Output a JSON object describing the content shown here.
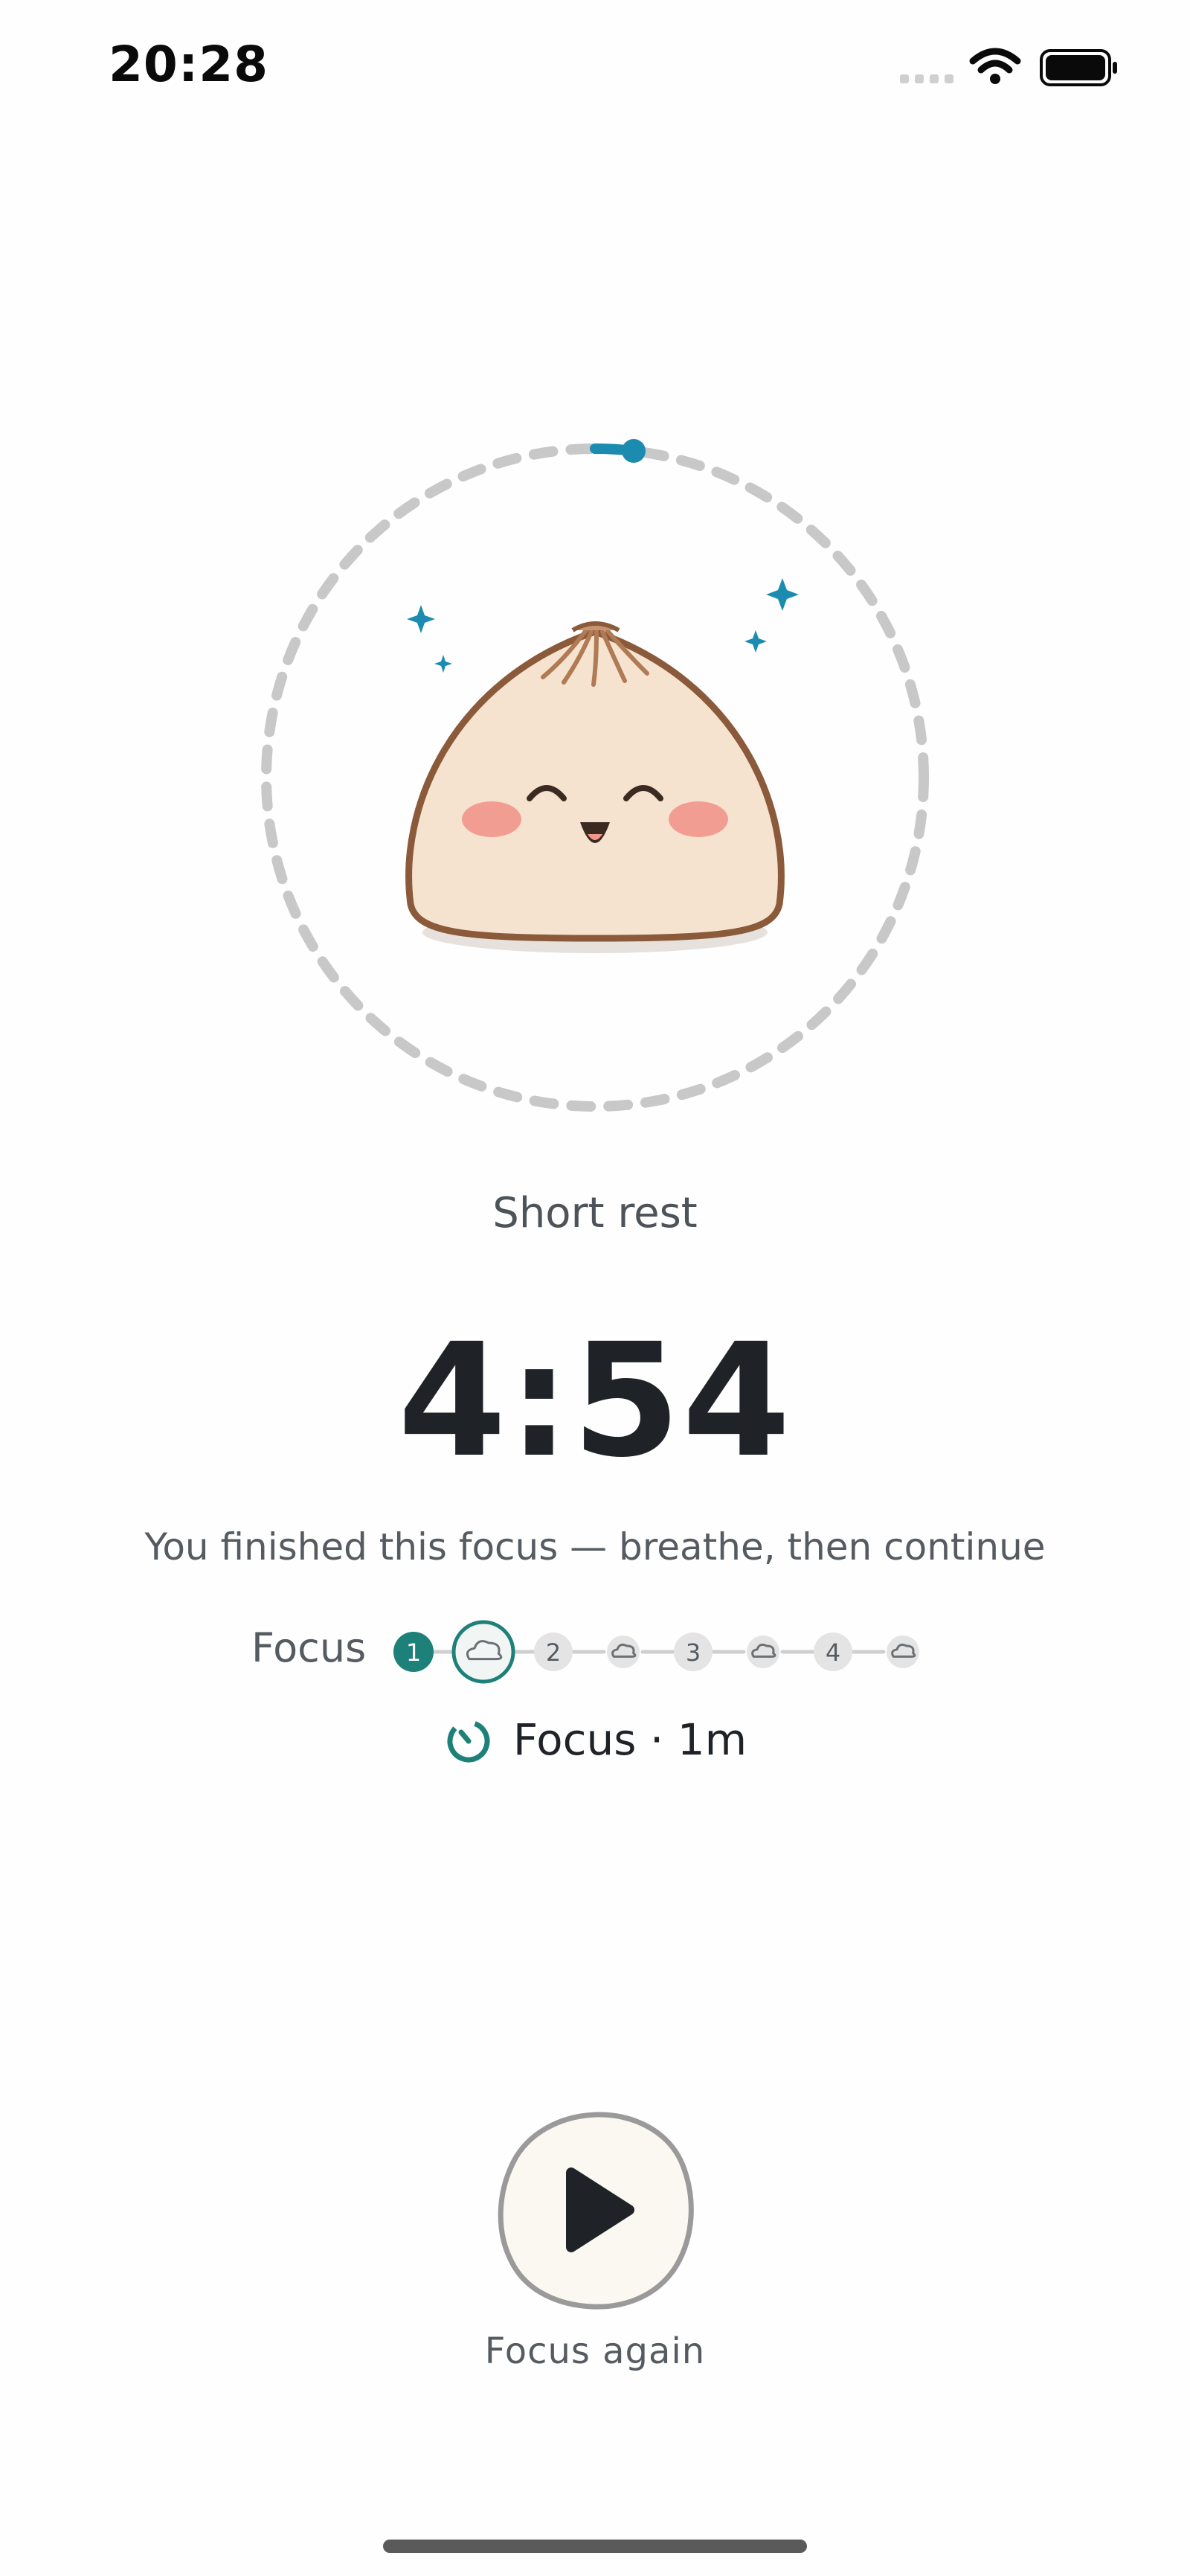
{
  "status_bar": {
    "time": "20:28",
    "signal_icon": "cellular-signal-icon",
    "wifi_icon": "wifi-icon",
    "battery_icon": "battery-icon"
  },
  "mascot": {
    "icon": "steamed-bun-mascot",
    "expression": "happy"
  },
  "ring": {
    "progress_fraction": 0.02,
    "accent": "#1b8cb0",
    "track": "#c8c8c8"
  },
  "mode_label": "Short rest",
  "timer": "4:54",
  "subtitle": "You finished this focus — breathe, then continue",
  "stepper": {
    "label": "Focus",
    "steps": [
      {
        "label": "1",
        "kind": "focus",
        "state": "done"
      },
      {
        "label": "",
        "kind": "rest",
        "state": "current"
      },
      {
        "label": "2",
        "kind": "focus",
        "state": "upcoming"
      },
      {
        "label": "",
        "kind": "rest",
        "state": "upcoming"
      },
      {
        "label": "3",
        "kind": "focus",
        "state": "upcoming"
      },
      {
        "label": "",
        "kind": "rest",
        "state": "upcoming"
      },
      {
        "label": "4",
        "kind": "focus",
        "state": "upcoming"
      },
      {
        "label": "",
        "kind": "rest",
        "state": "upcoming"
      }
    ]
  },
  "next_session": {
    "icon": "timer-icon",
    "text": "Focus · 1m"
  },
  "play_button": {
    "icon": "play-icon",
    "caption": "Focus again"
  },
  "colors": {
    "teal": "#1d8079",
    "accent_blue": "#1b8cb0",
    "bun_fill": "#f6e3cf",
    "bun_outline": "#8a5a3b",
    "cheek": "#f2958b"
  }
}
